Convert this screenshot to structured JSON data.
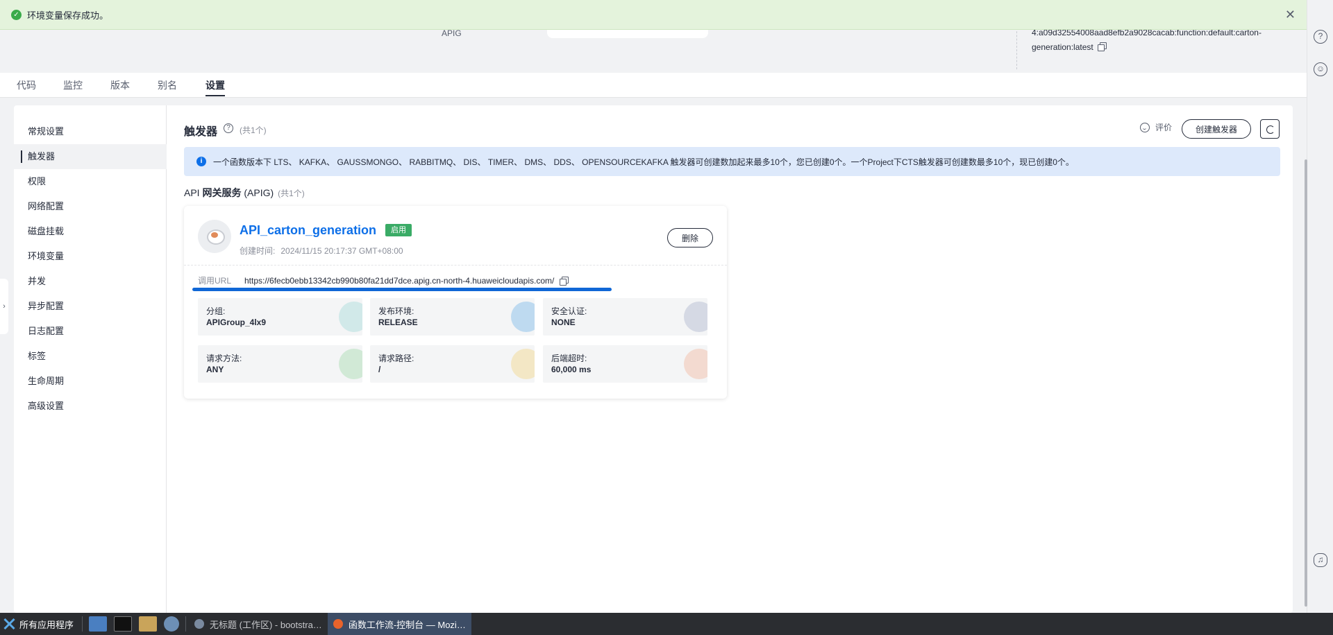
{
  "toast": {
    "message": "环境变量保存成功。"
  },
  "header": {
    "apig_label": "APIG",
    "urn_text": "4:a09d32554008aad8efb2a9028cacab:function:default:carton-generation:latest"
  },
  "tabs": [
    {
      "label": "代码"
    },
    {
      "label": "监控"
    },
    {
      "label": "版本"
    },
    {
      "label": "别名"
    },
    {
      "label": "设置"
    }
  ],
  "sidebar": {
    "items": [
      {
        "label": "常规设置"
      },
      {
        "label": "触发器"
      },
      {
        "label": "权限"
      },
      {
        "label": "网络配置"
      },
      {
        "label": "磁盘挂载"
      },
      {
        "label": "环境变量"
      },
      {
        "label": "并发"
      },
      {
        "label": "异步配置"
      },
      {
        "label": "日志配置"
      },
      {
        "label": "标签"
      },
      {
        "label": "生命周期"
      },
      {
        "label": "高级设置"
      }
    ]
  },
  "section": {
    "title": "触发器",
    "count": "(共1个)",
    "rate_label": "评价",
    "create_label": "创建触发器",
    "info_text": "一个函数版本下 LTS、 KAFKA、 GAUSSMONGO、 RABBITMQ、 DIS、 TIMER、 DMS、 DDS、 OPENSOURCEKAFKA 触发器可创建数加起来最多10个，您已创建0个。一个Project下CTS触发器可创建数最多10个，现已创建0个。"
  },
  "group": {
    "prefix": "API ",
    "title": "网关服务",
    "suffix": " (APIG)",
    "count": "(共1个)"
  },
  "trigger": {
    "name": "API_carton_generation",
    "status": "启用",
    "created_label": "创建时间:",
    "created_value": "2024/11/15 20:17:37 GMT+08:00",
    "delete_label": "删除",
    "url_label": "调用URL",
    "url": "https://6fecb0ebb13342cb990b80fa21dd7dce.apig.cn-north-4.huaweicloudapis.com/",
    "details": [
      {
        "label": "分组:",
        "value": "APIGroup_4lx9",
        "icon": "group-icon",
        "color": "#8fd4d0"
      },
      {
        "label": "发布环境:",
        "value": "RELEASE",
        "icon": "code-icon",
        "color": "#5aa9e6"
      },
      {
        "label": "安全认证:",
        "value": "NONE",
        "icon": "shield-icon",
        "color": "#9aa7c4"
      },
      {
        "label": "请求方法:",
        "value": "ANY",
        "icon": "method-icon",
        "color": "#8fd49a"
      },
      {
        "label": "请求路径:",
        "value": "/",
        "icon": "path-icon",
        "color": "#f0cd6a"
      },
      {
        "label": "后端超时:",
        "value": "60,000 ms",
        "icon": "clock-icon",
        "color": "#f2a98a"
      }
    ]
  },
  "taskbar": {
    "start_label": "所有应用程序",
    "tasks": [
      {
        "label": "无标题 (工作区) - bootstra…"
      },
      {
        "label": "函数工作流-控制台 — Mozi…"
      }
    ]
  }
}
